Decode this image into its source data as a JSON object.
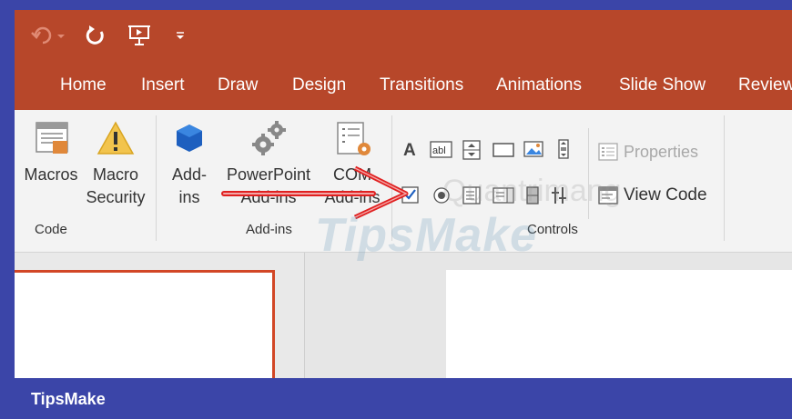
{
  "qat": {
    "undo_icon": "undo-icon",
    "repeat_icon": "repeat-icon",
    "present_icon": "present-from-start-icon",
    "customize_icon": "customize-qat-icon"
  },
  "tabs": [
    {
      "label": "Home"
    },
    {
      "label": "Insert"
    },
    {
      "label": "Draw"
    },
    {
      "label": "Design"
    },
    {
      "label": "Transitions"
    },
    {
      "label": "Animations"
    },
    {
      "label": "Slide Show"
    },
    {
      "label": "Review"
    }
  ],
  "ribbon": {
    "code": {
      "macros_label": "Macros",
      "macro_security_line1": "Macro",
      "macro_security_line2": "Security",
      "group_label": "Code"
    },
    "addins": {
      "addins_line1": "Add-",
      "addins_line2": "ins",
      "ppt_addins_line1": "PowerPoint",
      "ppt_addins_line2": "Add-ins",
      "com_addins_line1": "COM",
      "com_addins_line2": "Add-ins",
      "group_label": "Add-ins"
    },
    "controls": {
      "properties_label": "Properties",
      "view_code_label": "View Code",
      "group_label": "Controls"
    }
  },
  "watermark": {
    "text": "TipsMake",
    "text2": "Quantrimang"
  },
  "footer": {
    "brand": "TipsMake"
  },
  "colors": {
    "titlebar": "#b7472a",
    "ribbon": "#f3f3f3",
    "frame": "#3b45a8",
    "arrow": "#e02020",
    "selection": "#d24726"
  }
}
